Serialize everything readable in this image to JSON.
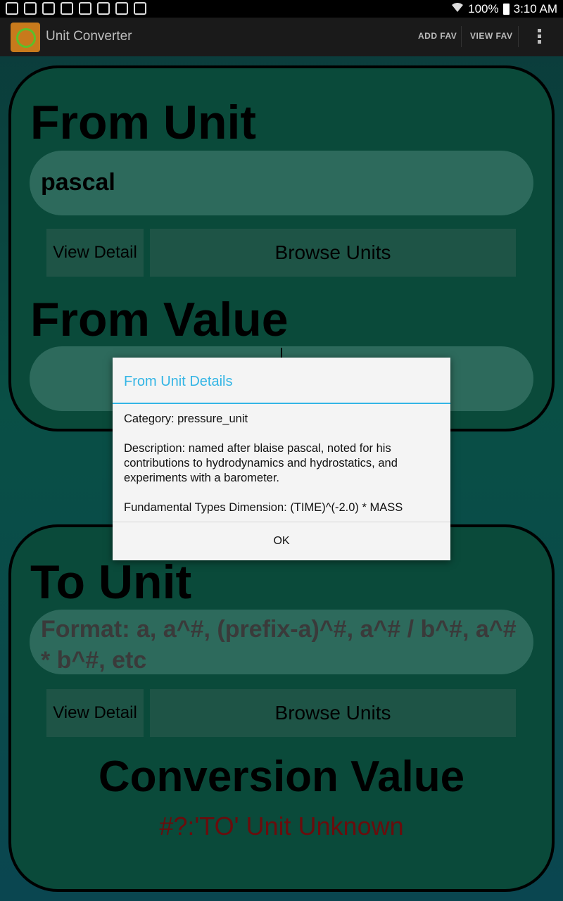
{
  "status_bar": {
    "icons": [
      "shield-icon",
      "gmail-icon",
      "bell-icon",
      "smiley-icon",
      "image-icon",
      "magnet-icon",
      "refresh-icon",
      "briefcase-icon"
    ],
    "wifi": "wifi-icon",
    "battery_text": "100%",
    "time": "3:10 AM"
  },
  "action_bar": {
    "title": "Unit Converter",
    "add_fav": "ADD FAV",
    "view_fav": "VIEW FAV",
    "overflow": "overflow-menu-icon"
  },
  "from_section": {
    "label": "From Unit",
    "unit_value": "pascal",
    "view_detail": "View Detail",
    "browse_units": "Browse Units",
    "value_label": "From Value",
    "value_input": ""
  },
  "to_section": {
    "label": "To Unit",
    "unit_placeholder": "Format: a, a^#, (prefix-a)^#, a^# / b^#, a^# * b^#, etc",
    "view_detail": "View Detail",
    "browse_units": "Browse Units",
    "conversion_label": "Conversion Value",
    "conversion_value": "#?:'TO' Unit Unknown"
  },
  "dialog": {
    "title": "From Unit Details",
    "category": "Category: pressure_unit",
    "description": "Description: named after blaise pascal, noted for his contributions to hydrodynamics and hydrostatics, and experiments with a barometer.",
    "dimension": "Fundamental Types Dimension: (TIME)^(-2.0) * MASS",
    "ok": "OK"
  },
  "colors": {
    "dialog_accent": "#33b5e5",
    "panel_fill": "#0a4a3a",
    "error_text": "#6a0c0c"
  }
}
